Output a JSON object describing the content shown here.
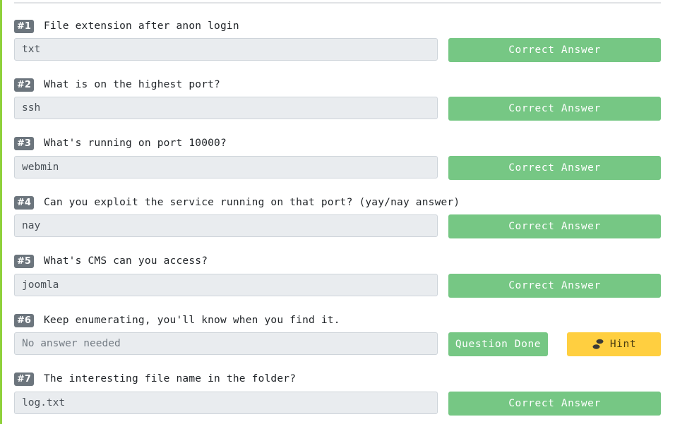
{
  "accent_colors": {
    "success": "#76c784",
    "hint": "#ffcf40",
    "badge": "#6c757d",
    "rail": "#8fd13b"
  },
  "tasks": [
    {
      "badge": "#1",
      "question": "File extension after anon login",
      "answer": "txt",
      "placeholder": false,
      "button": "Correct Answer"
    },
    {
      "badge": "#2",
      "question": "What is on the highest port?",
      "answer": "ssh",
      "placeholder": false,
      "button": "Correct Answer"
    },
    {
      "badge": "#3",
      "question": "What's running on port 10000?",
      "answer": "webmin",
      "placeholder": false,
      "button": "Correct Answer"
    },
    {
      "badge": "#4",
      "question": "Can you exploit the service running on that port? (yay/nay answer)",
      "answer": "nay",
      "placeholder": false,
      "button": "Correct Answer"
    },
    {
      "badge": "#5",
      "question": "What's CMS can you access?",
      "answer": "joomla",
      "placeholder": false,
      "button": "Correct Answer"
    },
    {
      "badge": "#6",
      "question": "Keep enumerating, you'll know when you find it.",
      "answer": "No answer needed",
      "placeholder": true,
      "button": "Question Done",
      "hint_label": "Hint",
      "hint_icon": "footprints-icon"
    },
    {
      "badge": "#7",
      "question": "The interesting file name in the folder?",
      "answer": "log.txt",
      "placeholder": false,
      "button": "Correct Answer"
    }
  ]
}
